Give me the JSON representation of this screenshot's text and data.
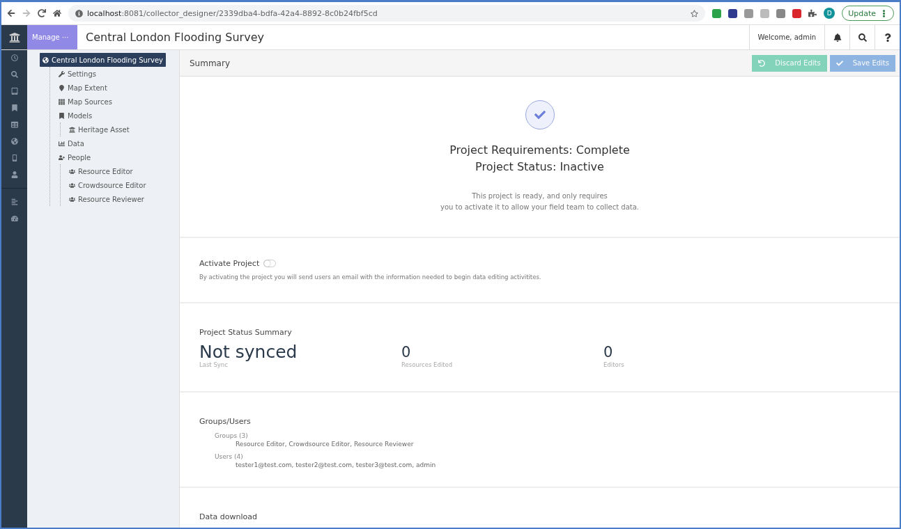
{
  "browser": {
    "url_host": "localhost",
    "url_path": ":8081/collector_designer/2339dba4-bdfa-42a4-8892-8c0b24fbf5cd",
    "profile_initial": "D",
    "update_label": "Update"
  },
  "header": {
    "manage_label": "Manage ···",
    "title": "Central London Flooding Survey",
    "welcome": "Welcome, admin"
  },
  "tree": [
    {
      "label": "Central London Flooding Survey",
      "kind": "project",
      "selected": true,
      "children": [
        {
          "label": "Settings",
          "kind": "settings",
          "selected": false
        },
        {
          "label": "Map Extent",
          "kind": "extent",
          "selected": false
        },
        {
          "label": "Map Sources",
          "kind": "sources",
          "selected": false
        },
        {
          "label": "Models",
          "kind": "models",
          "selected": false,
          "children": [
            {
              "label": "Heritage Asset",
              "kind": "model",
              "selected": false
            }
          ]
        },
        {
          "label": "Data",
          "kind": "data",
          "selected": false
        },
        {
          "label": "People",
          "kind": "people",
          "selected": false,
          "children": [
            {
              "label": "Resource Editor",
              "kind": "group",
              "selected": false
            },
            {
              "label": "Crowdsource Editor",
              "kind": "group",
              "selected": false
            },
            {
              "label": "Resource Reviewer",
              "kind": "group",
              "selected": false
            }
          ]
        }
      ]
    }
  ],
  "summary": {
    "title": "Summary",
    "buttons": [
      {
        "label": "Discard Edits",
        "kind": "discard"
      },
      {
        "label": "Save Edits",
        "kind": "save"
      }
    ]
  },
  "status": {
    "requirements": "Project Requirements: Complete",
    "project_status": "Project Status: Inactive",
    "message": [
      "This project is ready, and only requires",
      "you to activate it to allow your field team to collect data."
    ]
  },
  "activate": {
    "label": "Activate Project",
    "on": false,
    "description": "By activating the project you will send users an email with the information needed to begin data editing activitites."
  },
  "status_summary": {
    "title": "Project Status Summary",
    "stats": [
      {
        "value": "Not synced",
        "label": "Last Sync"
      },
      {
        "value": "0",
        "label": "Resources Edited"
      },
      {
        "value": "0",
        "label": "Editors"
      }
    ]
  },
  "groups_users": {
    "title": "Groups/Users",
    "entries": [
      {
        "label": "Groups (3)",
        "value": "Resource Editor, Crowdsource Editor, Resource Reviewer"
      },
      {
        "label": "Users (4)",
        "value": "tester1@test.com, tester2@test.com, tester3@test.com, admin"
      }
    ]
  },
  "data_download": {
    "title": "Data download"
  }
}
